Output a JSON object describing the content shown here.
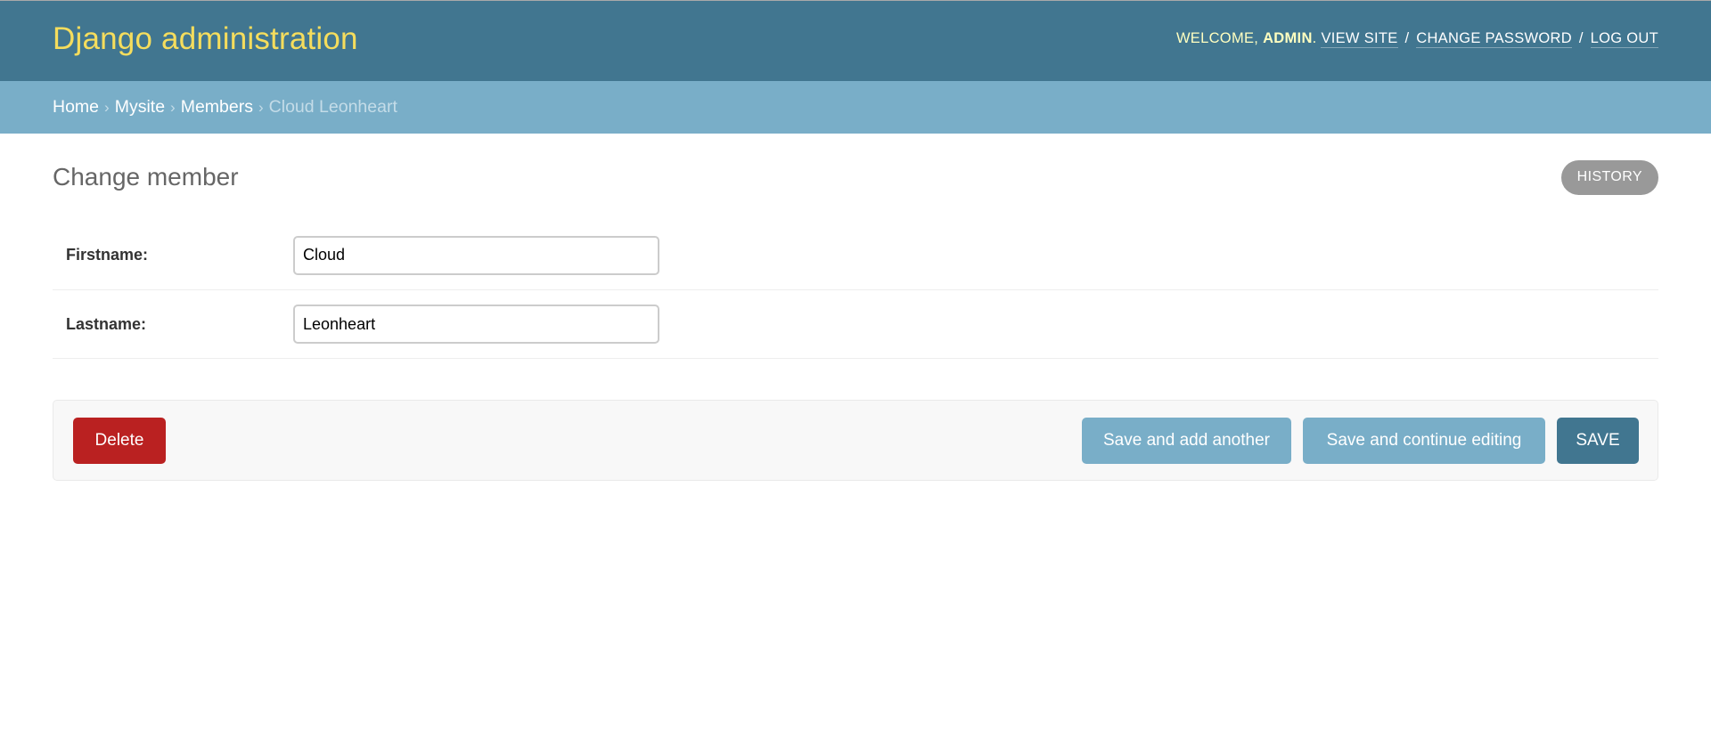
{
  "header": {
    "site_name": "Django administration",
    "welcome_prefix": "Welcome,",
    "username": "admin",
    "welcome_suffix": ".",
    "links": {
      "view_site": "View site",
      "change_password": "Change password",
      "log_out": "Log out"
    },
    "separator": "/"
  },
  "breadcrumbs": {
    "items": [
      "Home",
      "Mysite",
      "Members"
    ],
    "current": "Cloud Leonheart",
    "separator": "›"
  },
  "page": {
    "title": "Change member",
    "history_label": "History"
  },
  "form": {
    "fields": [
      {
        "label": "Firstname:",
        "value": "Cloud"
      },
      {
        "label": "Lastname:",
        "value": "Leonheart"
      }
    ]
  },
  "submit_row": {
    "delete_label": "Delete",
    "save_add_another_label": "Save and add another",
    "save_continue_label": "Save and continue editing",
    "save_label": "Save"
  },
  "colors": {
    "header_bg": "#417690",
    "breadcrumb_bg": "#79aec8",
    "site_name": "#f5dd5d",
    "delete": "#ba2121",
    "save": "#417690",
    "secondary_button": "#79aec8",
    "history_button": "#999999"
  }
}
